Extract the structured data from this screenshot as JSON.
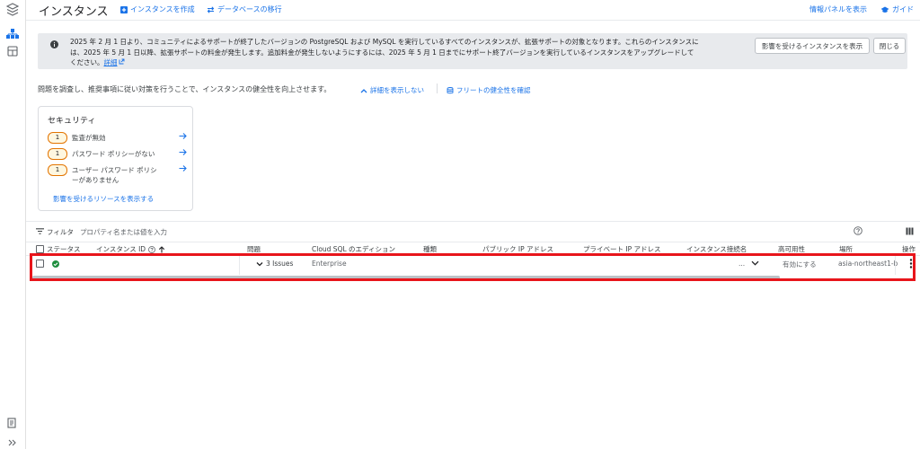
{
  "header": {
    "title": "インスタンス",
    "create_label": "インスタンスを作成",
    "migrate_label": "データベースの移行",
    "info_panel_label": "情報パネルを表示",
    "guide_label": "ガイド"
  },
  "banner": {
    "text_line1": "2025 年 2 月 1 日より、コミュニティによるサポートが終了したバージョンの PostgreSQL および MySQL を実行しているすべてのインスタンスが、拡張サポートの対象となります。これらのインスタンスに",
    "text_line2": "は、2025 年 5 月 1 日以降、拡張サポートの料金が発生します。追加料金が発生しないようにするには、2025 年 5 月 1 日までにサポート終了バージョンを実行しているインスタンスをアップグレードして",
    "text_line3": "ください。",
    "details_link": "詳細",
    "show_affected_label": "影響を受けるインスタンスを表示",
    "close_label": "閉じる"
  },
  "description": {
    "text": "問題を調査し、推奨事項に従い対策を行うことで、インスタンスの健全性を向上させます。",
    "hide_details_label": "詳細を表示しない",
    "fleet_health_label": "フリートの健全性を確認"
  },
  "security_card": {
    "title": "セキュリティ",
    "items": [
      {
        "count": "1",
        "label": "監査が無効"
      },
      {
        "count": "1",
        "label": "パスワード ポリシーがない"
      },
      {
        "count": "1",
        "label": "ユーザー パスワード ポリシーがありません"
      }
    ],
    "show_resources_label": "影響を受けるリソースを表示する"
  },
  "filter": {
    "label": "フィルタ",
    "placeholder": "プロパティ名または値を入力"
  },
  "table": {
    "headers": {
      "status": "ステータス",
      "instance_id": "インスタンス ID",
      "issues": "問題",
      "edition": "Cloud SQL のエディション",
      "type": "種類",
      "public_ip": "パブリック IP アドレス",
      "private_ip": "プライベート IP アドレス",
      "connection_name": "インスタンス接続名",
      "high_availability": "高可用性",
      "location": "場所",
      "actions": "操作"
    },
    "rows": [
      {
        "issues": "3 Issues",
        "edition": "Enterprise",
        "connection_ellipsis": "...",
        "high_availability": "有効にする",
        "location": "asia-northeast1-b"
      }
    ]
  },
  "colors": {
    "accent": "#1a73e8",
    "highlight": "#e8151b",
    "badge_border": "#e37400",
    "status_ok": "#1e8e3e"
  }
}
